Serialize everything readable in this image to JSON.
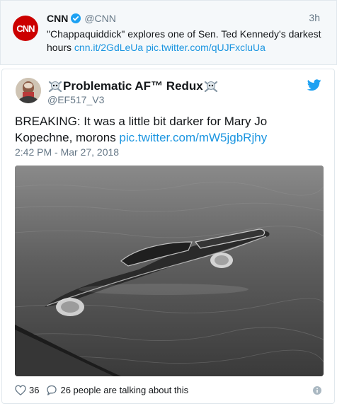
{
  "quoted_tweet": {
    "name": "CNN",
    "handle": "@CNN",
    "time": "3h",
    "logo_text": "CNN",
    "text": "\"Chappaquiddick\" explores one of Sen. Ted Kennedy's darkest hours ",
    "link1": "cnn.it/2GdLeUa",
    "link2": "pic.twitter.com/qUJFxcluUa"
  },
  "tweet": {
    "display_name": "Problematic AF™ Redux",
    "handle": "@EF517_V3",
    "text": "BREAKING: It was a little bit darker for Mary Jo Kopechne, morons ",
    "link": "pic.twitter.com/mW5jgbRjhy",
    "timestamp": "2:42 PM - Mar 27, 2018",
    "likes": "36",
    "replies_label": "26 people are talking about this"
  },
  "icons": {
    "verified": "verified-badge-icon",
    "skull": "skull-crossbones-icon",
    "bird": "twitter-bird-icon",
    "like": "heart-icon",
    "reply": "reply-bubble-icon",
    "info": "info-icon"
  },
  "colors": {
    "link": "#1b95e0",
    "cnn_red": "#cc0000",
    "twitter_blue": "#1da1f2",
    "secondary_text": "#657786"
  }
}
